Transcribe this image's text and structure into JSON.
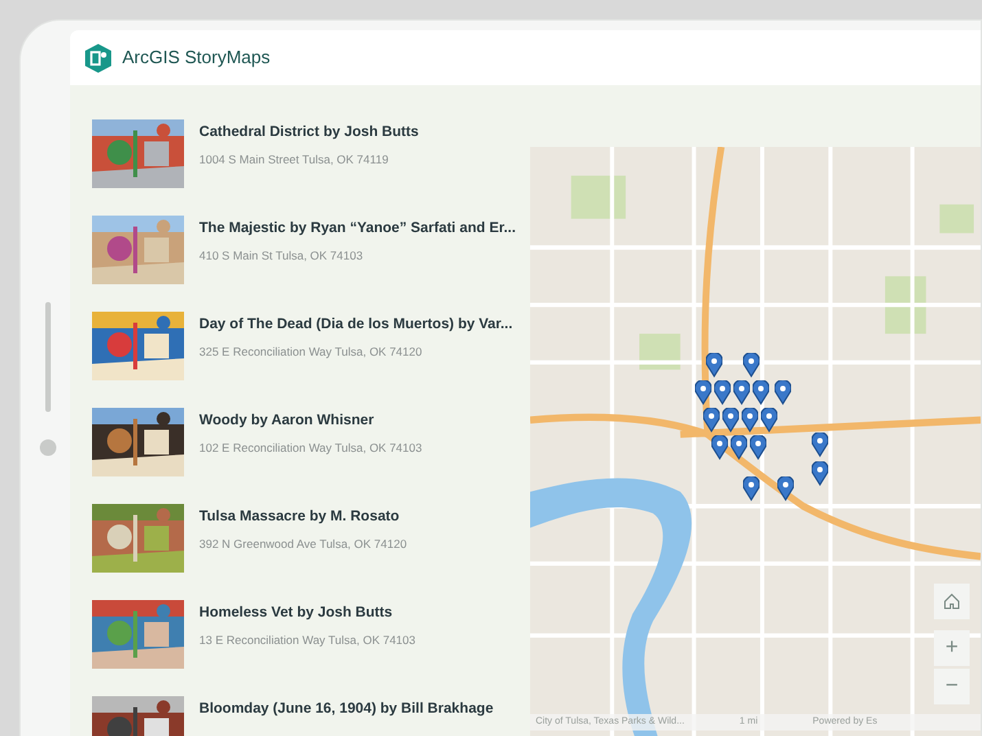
{
  "header": {
    "title": "ArcGIS StoryMaps"
  },
  "tours": [
    {
      "title": "Cathedral District by Josh Butts",
      "address": "1004 S Main Street Tulsa, OK 74119"
    },
    {
      "title": "The Majestic by Ryan “Yanoe” Sarfati and Er...",
      "address": "410 S Main St Tulsa, OK 74103"
    },
    {
      "title": "Day of The Dead (Dia de los Muertos) by Var...",
      "address": "325 E Reconciliation Way Tulsa, OK 74120"
    },
    {
      "title": "Woody by Aaron Whisner",
      "address": "102 E Reconciliation Way Tulsa, OK 74103"
    },
    {
      "title": "Tulsa Massacre by M. Rosato",
      "address": "392 N Greenwood Ave Tulsa, OK 74120"
    },
    {
      "title": "Homeless Vet by Josh Butts",
      "address": "13 E Reconciliation Way Tulsa, OK 74103"
    },
    {
      "title": "Bloomday (June 16, 1904) by Bill Brakhage"
    }
  ],
  "map": {
    "kind": "picture",
    "zoom_in": "+",
    "zoom_out": "−",
    "attribution": "City of Tulsa, Texas Parks & Wild...",
    "scale": "1 mi",
    "powered_by": "Powered by Es"
  }
}
